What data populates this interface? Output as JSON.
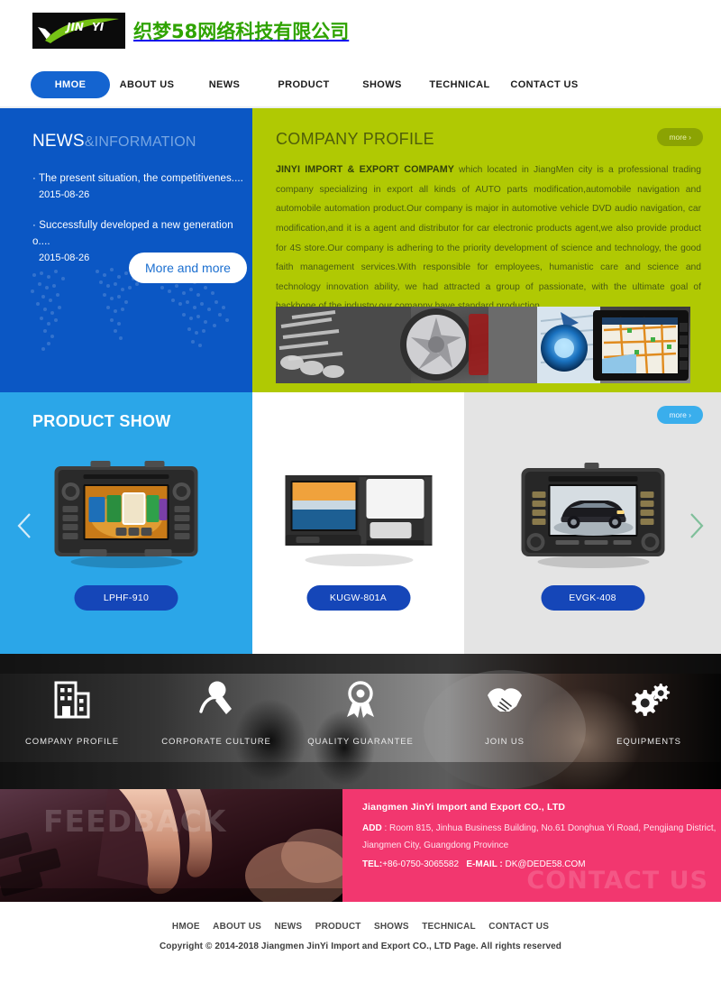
{
  "header": {
    "logo_mark": "jinyi-checkmark-logo",
    "logo_brand_text": "JIN YI",
    "company_name_cn": "织梦58网络科技有限公司"
  },
  "nav": {
    "items": [
      {
        "label": "HMOE",
        "active": true
      },
      {
        "label": "ABOUT US",
        "active": false
      },
      {
        "label": "NEWS",
        "active": false
      },
      {
        "label": "PRODUCT",
        "active": false
      },
      {
        "label": "SHOWS",
        "active": false
      },
      {
        "label": "TECHNICAL",
        "active": false
      },
      {
        "label": "CONTACT US",
        "active": false
      }
    ]
  },
  "news": {
    "title_main": "NEWS",
    "title_sub": "&INFORMATION",
    "items": [
      {
        "title": "· The present situation, the competitivenes....",
        "date": "2015-08-26"
      },
      {
        "title": "· Successfully developed a new generation o....",
        "date": "2015-08-26"
      }
    ],
    "more_label": "More and more"
  },
  "profile": {
    "title": "COMPANY PROFILE",
    "more_label": "more ›",
    "lead": "JINYI IMPORT & EXPORT COMPAMY",
    "body": " which located in JiangMen city is a professional trading company specializing in export all kinds of AUTO parts modification,automobile navigation and automobile automation product.Our company is major in automotive vehicle DVD audio navigation, car modification,and it is a agent and distributor for car electronic products agent,we also provide product for 4S store.Our company is adhering to the priority development of science and technology, the good faith management services.With responsible for employees, humanistic care and science and technology innovation ability, we had attracted a group of passionate, with the ultimate goal of backbone of the industry,our comapny have standard production ...",
    "strip_image": "auto-parts-wheel-gps-banner"
  },
  "product_show": {
    "title": "PRODUCT SHOW",
    "more_label": "more ›",
    "prev_icon": "chevron-left-icon",
    "next_icon": "chevron-right-icon",
    "items": [
      {
        "name": "LPHF-910",
        "image": "car-dvd-navigation-unit-1"
      },
      {
        "name": "KUGW-801A",
        "image": "car-dvd-navigation-unit-2"
      },
      {
        "name": "EVGK-408",
        "image": "car-dvd-navigation-unit-3"
      }
    ]
  },
  "features": {
    "items": [
      {
        "label": "COMPANY PROFILE",
        "icon": "building-icon"
      },
      {
        "label": "CORPORATE CULTURE",
        "icon": "microphone-icon"
      },
      {
        "label": "QUALITY GUARANTEE",
        "icon": "award-ribbon-icon"
      },
      {
        "label": "JOIN US",
        "icon": "handshake-icon"
      },
      {
        "label": "EQUIPMENTS",
        "icon": "gears-icon"
      }
    ]
  },
  "feedback": {
    "word": "FEEDBACK",
    "image": "hand-typing-on-keyboard"
  },
  "contact": {
    "ghost_word": "CONTACT US",
    "company": "Jiangmen JinYi Import and Export CO., LTD",
    "add_label": "ADD",
    "address": " : Room 815, Jinhua Business Building, No.61 Donghua Yi Road, Pengjiang District, Jiangmen City, Guangdong Province",
    "tel_label": "TEL:",
    "tel": "+86-0750-3065582",
    "email_label": "E-MAIL :",
    "email": "DK@DEDE58.COM"
  },
  "footer": {
    "nav": [
      "HMOE",
      "ABOUT US",
      "NEWS",
      "PRODUCT",
      "SHOWS",
      "TECHNICAL",
      "CONTACT US"
    ],
    "copyright": "Copyright © 2014-2018 Jiangmen JinYi Import and Export CO., LTD   Page. All rights reserved"
  },
  "colors": {
    "nav_active": "#1464d0",
    "news_blue": "#0b57c4",
    "profile_green": "#b0c903",
    "product_blue": "#2ba6e8",
    "product_btn": "#1546b8",
    "contact_pink": "#f2376f",
    "logo_green": "#2fa300"
  }
}
